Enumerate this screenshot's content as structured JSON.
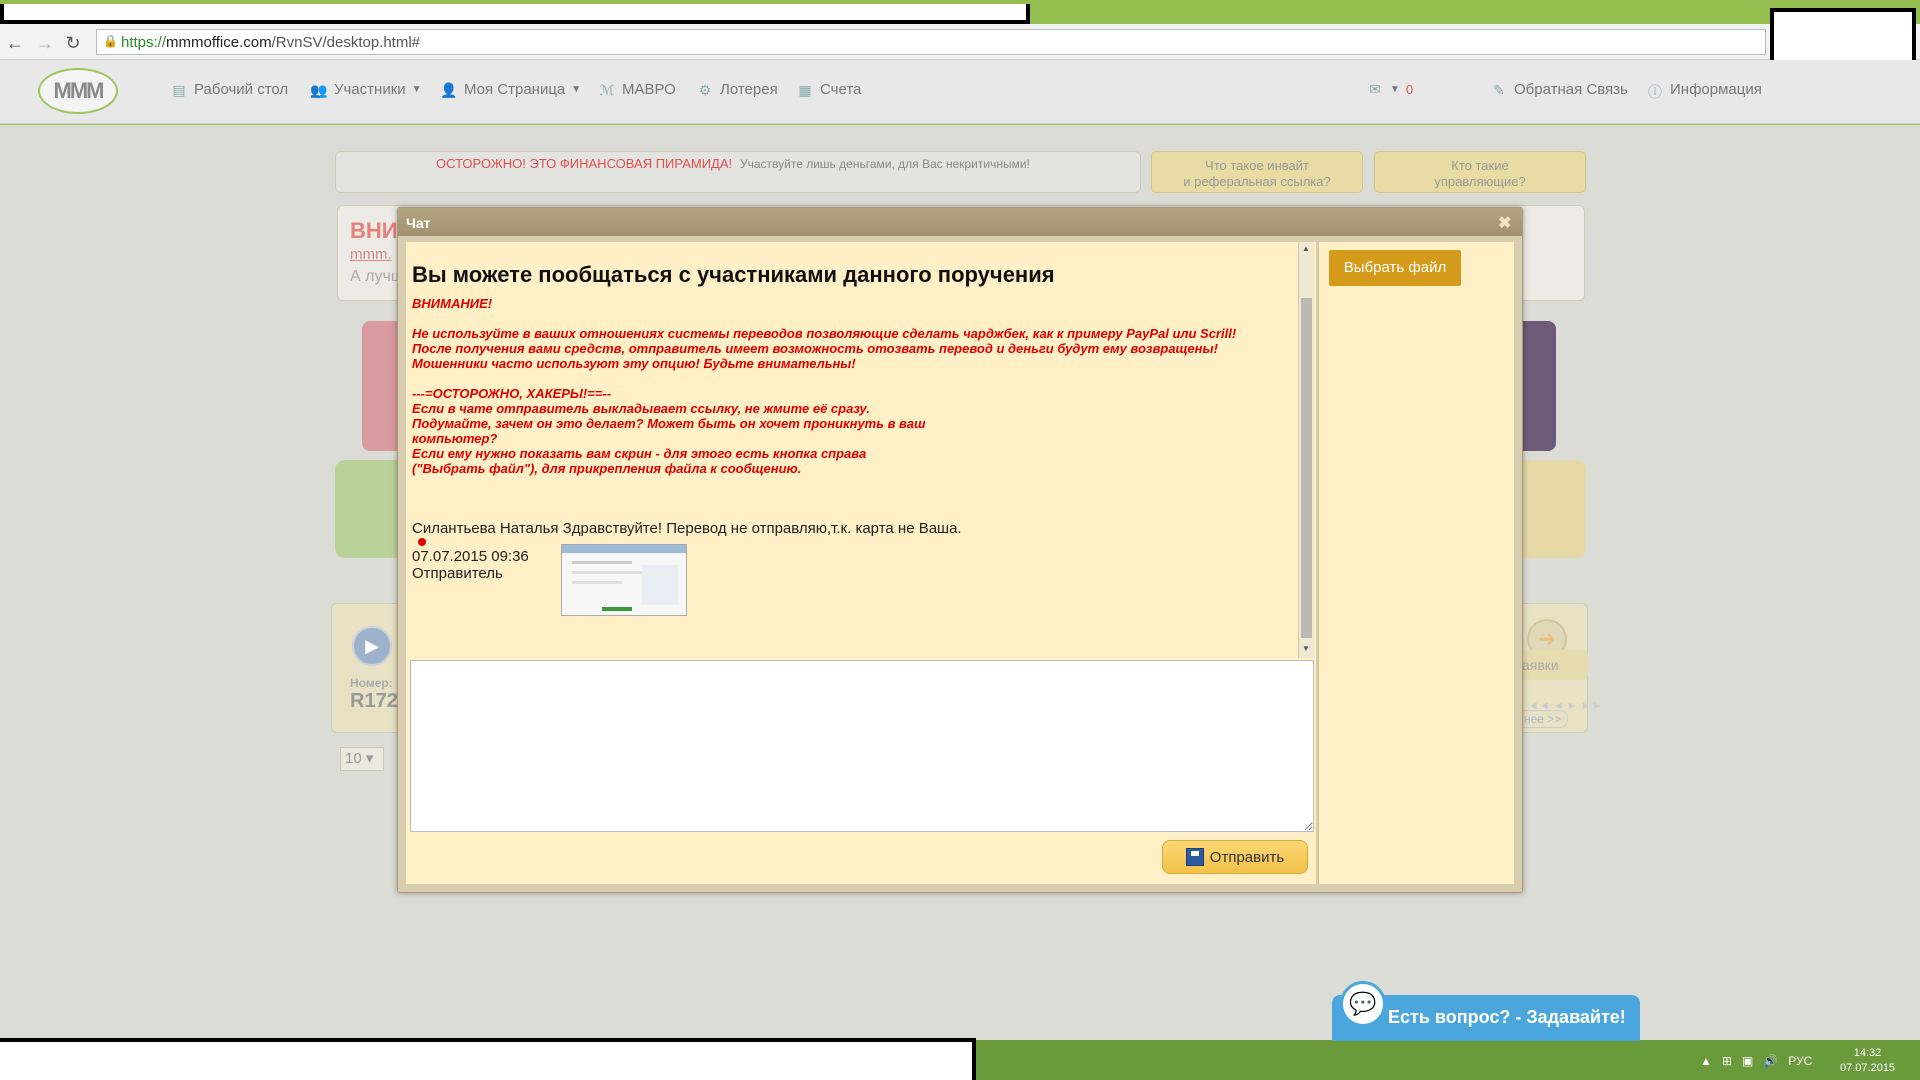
{
  "browser": {
    "url_protocol": "https://",
    "url_host": "mmmoffice.com",
    "url_path": "/RvnSV/desktop.html#"
  },
  "header": {
    "logo_text": "MMM",
    "menu": [
      {
        "label": "Рабочий стол",
        "icon": "desktop-icon"
      },
      {
        "label": "Участники",
        "icon": "users-icon"
      },
      {
        "label": "Моя Страница",
        "icon": "user-icon"
      },
      {
        "label": "МАВРО",
        "icon": "mavro-icon"
      },
      {
        "label": "Лотерея",
        "icon": "lottery-icon"
      },
      {
        "label": "Счета",
        "icon": "accounts-icon"
      }
    ],
    "notifications_count": "0",
    "feedback_label": "Обратная Связь",
    "info_label": "Информация"
  },
  "page": {
    "warning_red": "ОСТОРОЖНО! ЭТО ФИНАНСОВАЯ ПИРАМИДА!",
    "warning_grey": "Участвуйте лишь деньгами, для Вас некритичными!",
    "invite_btn_line1": "Что такое инвайт",
    "invite_btn_line2": "и реферальная ссылка?",
    "managers_btn_line1": "Кто такие",
    "managers_btn_line2": "управляющие?",
    "attention_title": "ВНИ",
    "attention_link": "mmm.",
    "attention_sub": "А лучш",
    "order_number_label": "Номер:",
    "order_number_value": "R172",
    "more_link": "нее >>",
    "bids_btn": "аявки",
    "pager_value": "10 ▾",
    "pager_dots": "◄◄ ◄ ► ►►"
  },
  "chat": {
    "title": "Чат",
    "close_glyph": "✖",
    "heading": "Вы можете пообщаться с участниками данного поручения",
    "warning_lines": [
      "ВНИМАНИЕ!",
      "Не используйте в ваших отношениях системы переводов позволяющие сделать чарджбек, как к примеру PayPal или Scrill!\nПосле получения вами средств, отправитель имеет возможность отозвать перевод и деньги будут ему возвращены!\nМошенники часто используют эту опцию! Будьте внимательны!",
      "---=ОСТОРОЖНО, ХАКЕРЫ!==--\nЕсли в чате отправитель выкладывает ссылку, не жмите её сразу.\nПодумайте, зачем он это делает? Может быть он хочет проникнуть в ваш\nкомпьютер?\nЕсли ему нужно показать вам скрин - для этого есть кнопка справа\n(\"Выбрать файл\"), для прикрепления файла к сообщению."
    ],
    "message": {
      "text": "Силантьева Наталья Здравствуйте! Перевод не отправляю,т.к. карта не Ваша.",
      "date": "07.07.2015 09:36",
      "role": "Отправитель"
    },
    "input_placeholder": "",
    "send_label": "Отправить",
    "file_btn": "Выбрать файл"
  },
  "help": {
    "text": "Есть вопрос? - Задавайте!"
  },
  "taskbar": {
    "lang": "РУС",
    "time": "14:32",
    "date": "07.07.2015"
  }
}
